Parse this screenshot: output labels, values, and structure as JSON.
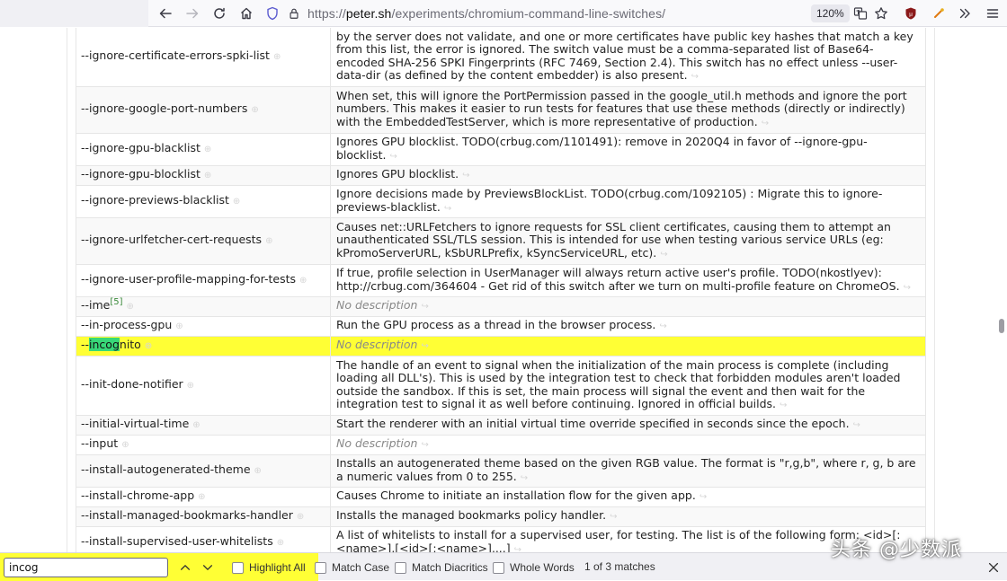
{
  "browser": {
    "url_prefix": "https://",
    "url_domain": "peter.sh",
    "url_path": "/experiments/chromium-command-line-switches/",
    "zoom": "120%",
    "icons": {
      "back": "arrow-left-icon",
      "forward": "arrow-right-icon",
      "reload": "reload-icon",
      "home": "home-icon",
      "tracking": "shield-icon",
      "lock": "lock-icon",
      "translate": "translate-icon",
      "bookmark": "star-icon",
      "ublock": "ublock-icon",
      "extension": "extension-icon",
      "overflow": "chevron-double-right-icon",
      "menu": "hamburger-menu-icon"
    }
  },
  "rows": [
    {
      "name": "--ignore-certificate-errors-spki-list",
      "desc": "by the server does not validate, and one or more certificates have public key hashes that match a key from this list, the error is ignored. The switch value must be a comma-separated list of Base64-encoded SHA-256 SPKI Fingerprints (RFC 7469, Section 2.4). This switch has no effect unless --user-data-dir (as defined by the content embedder) is also present."
    },
    {
      "name": "--ignore-google-port-numbers",
      "desc": "When set, this will ignore the PortPermission passed in the google_util.h methods and ignore the port numbers. This makes it easier to run tests for features that use these methods (directly or indirectly) with the EmbeddedTestServer, which is more representative of production."
    },
    {
      "name": "--ignore-gpu-blacklist",
      "desc": "Ignores GPU blocklist. TODO(crbug.com/1101491): remove in 2020Q4 in favor of --ignore-gpu-blocklist."
    },
    {
      "name": "--ignore-gpu-blocklist",
      "desc": "Ignores GPU blocklist."
    },
    {
      "name": "--ignore-previews-blacklist",
      "desc": "Ignore decisions made by PreviewsBlockList. TODO(crbug.com/1092105) : Migrate this to ignore-previews-blacklist."
    },
    {
      "name": "--ignore-urlfetcher-cert-requests",
      "desc": "Causes net::URLFetchers to ignore requests for SSL client certificates, causing them to attempt an unauthenticated SSL/TLS session. This is intended for use when testing various service URLs (eg: kPromoServerURL, kSbURLPrefix, kSyncServiceURL, etc)."
    },
    {
      "name": "--ignore-user-profile-mapping-for-tests",
      "desc": "If true, profile selection in UserManager will always return active user's profile. TODO(nkostlyev): http://crbug.com/364604 - Get rid of this switch after we turn on multi-profile feature on ChromeOS."
    },
    {
      "name": "--ime",
      "sup": "[5]",
      "desc": "No description",
      "nodesc": true
    },
    {
      "name": "--in-process-gpu",
      "desc": "Run the GPU process as a thread in the browser process."
    },
    {
      "name_pre": "--",
      "name_match": "incog",
      "name_post": "nito",
      "desc": "No description",
      "nodesc": true,
      "highlight": true
    },
    {
      "name": "--init-done-notifier",
      "desc": "The handle of an event to signal when the initialization of the main process is complete (including loading all DLL's). This is used by the integration test to check that forbidden modules aren't loaded outside the sandbox. If this is set, the main process will signal the event and then wait for the integration test to signal it as well before continuing. Ignored in official builds."
    },
    {
      "name": "--initial-virtual-time",
      "desc": "Start the renderer with an initial virtual time override specified in seconds since the epoch."
    },
    {
      "name": "--input",
      "desc": "No description",
      "nodesc": true
    },
    {
      "name": "--install-autogenerated-theme",
      "desc": "Installs an autogenerated theme based on the given RGB value. The format is \"r,g,b\", where r, g, b are a numeric values from 0 to 255."
    },
    {
      "name": "--install-chrome-app",
      "desc": "Causes Chrome to initiate an installation flow for the given app."
    },
    {
      "name": "--install-managed-bookmarks-handler",
      "desc": "Installs the managed bookmarks policy handler."
    },
    {
      "name": "--install-supervised-user-whitelists",
      "desc": "A list of whitelists to install for a supervised user, for testing. The list is of the following form: <id>[:<name>],[<id>[:<name>],...]"
    }
  ],
  "findbar": {
    "query": "incog",
    "highlight_all": "Highlight All",
    "match_case": "Match Case",
    "match_diacritics": "Match Diacritics",
    "whole_words": "Whole Words",
    "matches": "1 of 3 matches"
  },
  "watermark": "头条 @少数派",
  "colors": {
    "find_highlight": "#ffff35",
    "current_match": "#38d878"
  }
}
